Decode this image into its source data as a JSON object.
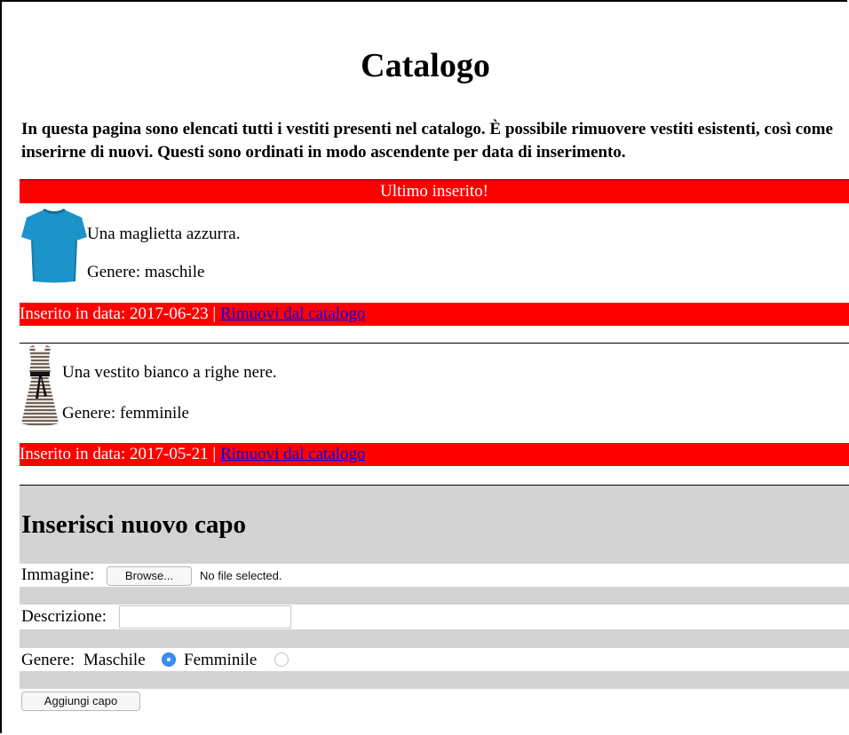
{
  "page": {
    "title": "Catalogo",
    "intro": "In questa pagina sono elencati tutti i vestiti presenti nel catalogo. È possibile rimuovere vestiti esistenti, così come inserirne di nuovi. Questi sono ordinati in modo ascendente per data di inserimento."
  },
  "catalog": {
    "latest_label": "Ultimo inserito!",
    "items": [
      {
        "image_icon": "tshirt-blue",
        "description": "Una maglietta azzurra.",
        "gender": "Genere: maschile",
        "date_text": "Inserito in data: 2017-06-23 |",
        "remove_label": "Rimuovi dal catalogo"
      },
      {
        "image_icon": "dress-striped",
        "description": "Una vestito bianco a righe nere.",
        "gender": "Genere: femminile",
        "date_text": "Inserito in data: 2017-05-21 |",
        "remove_label": "Rimuovi dal catalogo"
      }
    ]
  },
  "form": {
    "title": "Inserisci nuovo capo",
    "image_label": "Immagine:",
    "browse_label": "Browse...",
    "file_status": "No file selected.",
    "description_label": "Descrizione:",
    "description_value": "",
    "gender_label": "Genere:",
    "male_label": "Maschile",
    "female_label": "Femminile",
    "selected_gender": "Maschile",
    "submit_label": "Aggiungi capo"
  },
  "colors": {
    "highlight": "#ff0000",
    "link": "#0000ee",
    "form_bg": "#d3d3d3",
    "radio_selected": "#3b8ff0"
  }
}
